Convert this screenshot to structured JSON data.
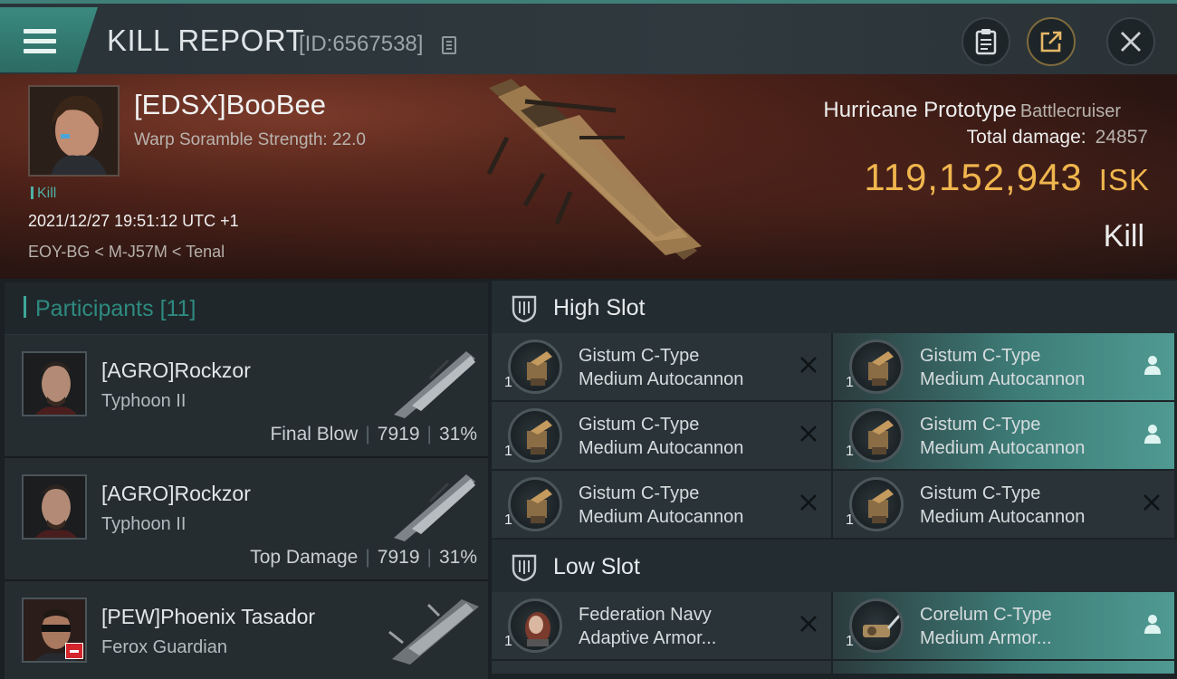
{
  "header": {
    "title": "KILL REPORT",
    "report_id": "[ID:6567538]"
  },
  "victim": {
    "name": "[EDSX]BooBee",
    "warp_scramble": "Warp Soramble Strength: 22.0",
    "result_tag": "Kill",
    "datetime": "2021/12/27 19:51:12 UTC +1",
    "location": "EOY-BG < M-J57M < Tenal",
    "ship_name": "Hurricane Prototype",
    "ship_class": "Battlecruiser",
    "total_damage_label": "Total damage:",
    "total_damage_value": "24857",
    "isk_value": "119,152,943",
    "isk_unit": "ISK",
    "outcome": "Kill"
  },
  "participants": {
    "title": "Participants",
    "count": "[11]",
    "items": [
      {
        "name": "[AGRO]Rockzor",
        "ship": "Typhoon II",
        "role": "Final Blow",
        "damage": "7919",
        "percent": "31%"
      },
      {
        "name": "[AGRO]Rockzor",
        "ship": "Typhoon II",
        "role": "Top Damage",
        "damage": "7919",
        "percent": "31%"
      },
      {
        "name": "[PEW]Phoenix Tasador",
        "ship": "Ferox Guardian",
        "role": "",
        "damage": "",
        "percent": ""
      }
    ]
  },
  "fittings": {
    "high_slot": {
      "title": "High Slot",
      "modules": [
        {
          "qty": "1",
          "line1": "Gistum C-Type",
          "line2": "Medium Autocannon",
          "state": "destroyed"
        },
        {
          "qty": "1",
          "line1": "Gistum C-Type",
          "line2": "Medium Autocannon",
          "state": "dropped"
        },
        {
          "qty": "1",
          "line1": "Gistum C-Type",
          "line2": "Medium Autocannon",
          "state": "destroyed"
        },
        {
          "qty": "1",
          "line1": "Gistum C-Type",
          "line2": "Medium Autocannon",
          "state": "dropped"
        },
        {
          "qty": "1",
          "line1": "Gistum C-Type",
          "line2": "Medium Autocannon",
          "state": "destroyed"
        },
        {
          "qty": "1",
          "line1": "Gistum C-Type",
          "line2": "Medium Autocannon",
          "state": "destroyed"
        }
      ]
    },
    "low_slot": {
      "title": "Low Slot",
      "modules": [
        {
          "qty": "1",
          "line1": "Federation Navy",
          "line2": "Adaptive Armor...",
          "state": "destroyed"
        },
        {
          "qty": "1",
          "line1": "Corelum C-Type",
          "line2": "Medium Armor...",
          "state": "dropped"
        }
      ]
    }
  },
  "colors": {
    "accent_teal": "#3fa699",
    "isk_gold": "#f0b64e",
    "dropped_fill": "#4f9a92",
    "badge_red": "#d3262c"
  },
  "icons": [
    "menu-icon",
    "copy-icon",
    "clipboard-icon",
    "share-icon",
    "close-icon",
    "shield-icon",
    "x-mark-icon",
    "person-icon"
  ]
}
